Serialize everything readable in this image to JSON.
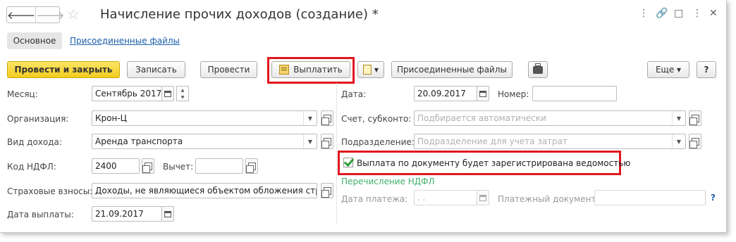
{
  "window": {
    "title": "Начисление прочих доходов (создание) *",
    "star": "☆",
    "controls": [
      "⋮",
      "🔗",
      "□",
      "⋮",
      "✕"
    ]
  },
  "nav": {
    "back": "🡐",
    "forward": "🡒"
  },
  "tabs": {
    "main": "Основное",
    "files": "Присоединенные файлы"
  },
  "toolbar": {
    "post_close": "Провести и закрыть",
    "save": "Записать",
    "post": "Провести",
    "pay": "Выплатить",
    "attached": "Присоединенные файлы",
    "more": "Еще ▾",
    "help": "?"
  },
  "left": {
    "month_label": "Месяц:",
    "month_value": "Сентябрь 2017",
    "org_label": "Организация:",
    "org_value": "Крон-Ц",
    "income_label": "Вид дохода:",
    "income_value": "Аренда транспорта",
    "ndfl_label": "Код НДФЛ:",
    "ndfl_value": "2400",
    "deduction_label": "Вычет:",
    "deduction_value": "",
    "insurance_label": "Страховые взносы:",
    "insurance_value": "Доходы, не являющиеся объектом обложения страх",
    "paydate_label": "Дата выплаты:",
    "paydate_value": "21.09.2017"
  },
  "right": {
    "date_label": "Дата:",
    "date_value": "20.09.2017",
    "number_label": "Номер:",
    "number_value": "",
    "account_label": "Счет, субконто:",
    "account_placeholder": "Подбирается автоматически",
    "division_label": "Подразделение:",
    "division_placeholder": "Подразделение для учета затрат",
    "checkbox_label": "Выплата по документу будет зарегистрирована ведомостью",
    "checkbox_checked": true,
    "ndfl_transfer": "Перечисление НДФЛ",
    "paydoc_date_label": "Дата платежа:",
    "paydoc_date_value": "  .  .",
    "paydoc_label": "Платежный документ:",
    "paydoc_value": "",
    "help": "?"
  },
  "colors": {
    "primary_button": "#f5d12a",
    "highlight": "#e0161e",
    "link": "#1a5eaa",
    "green_link": "#3fb06a"
  }
}
